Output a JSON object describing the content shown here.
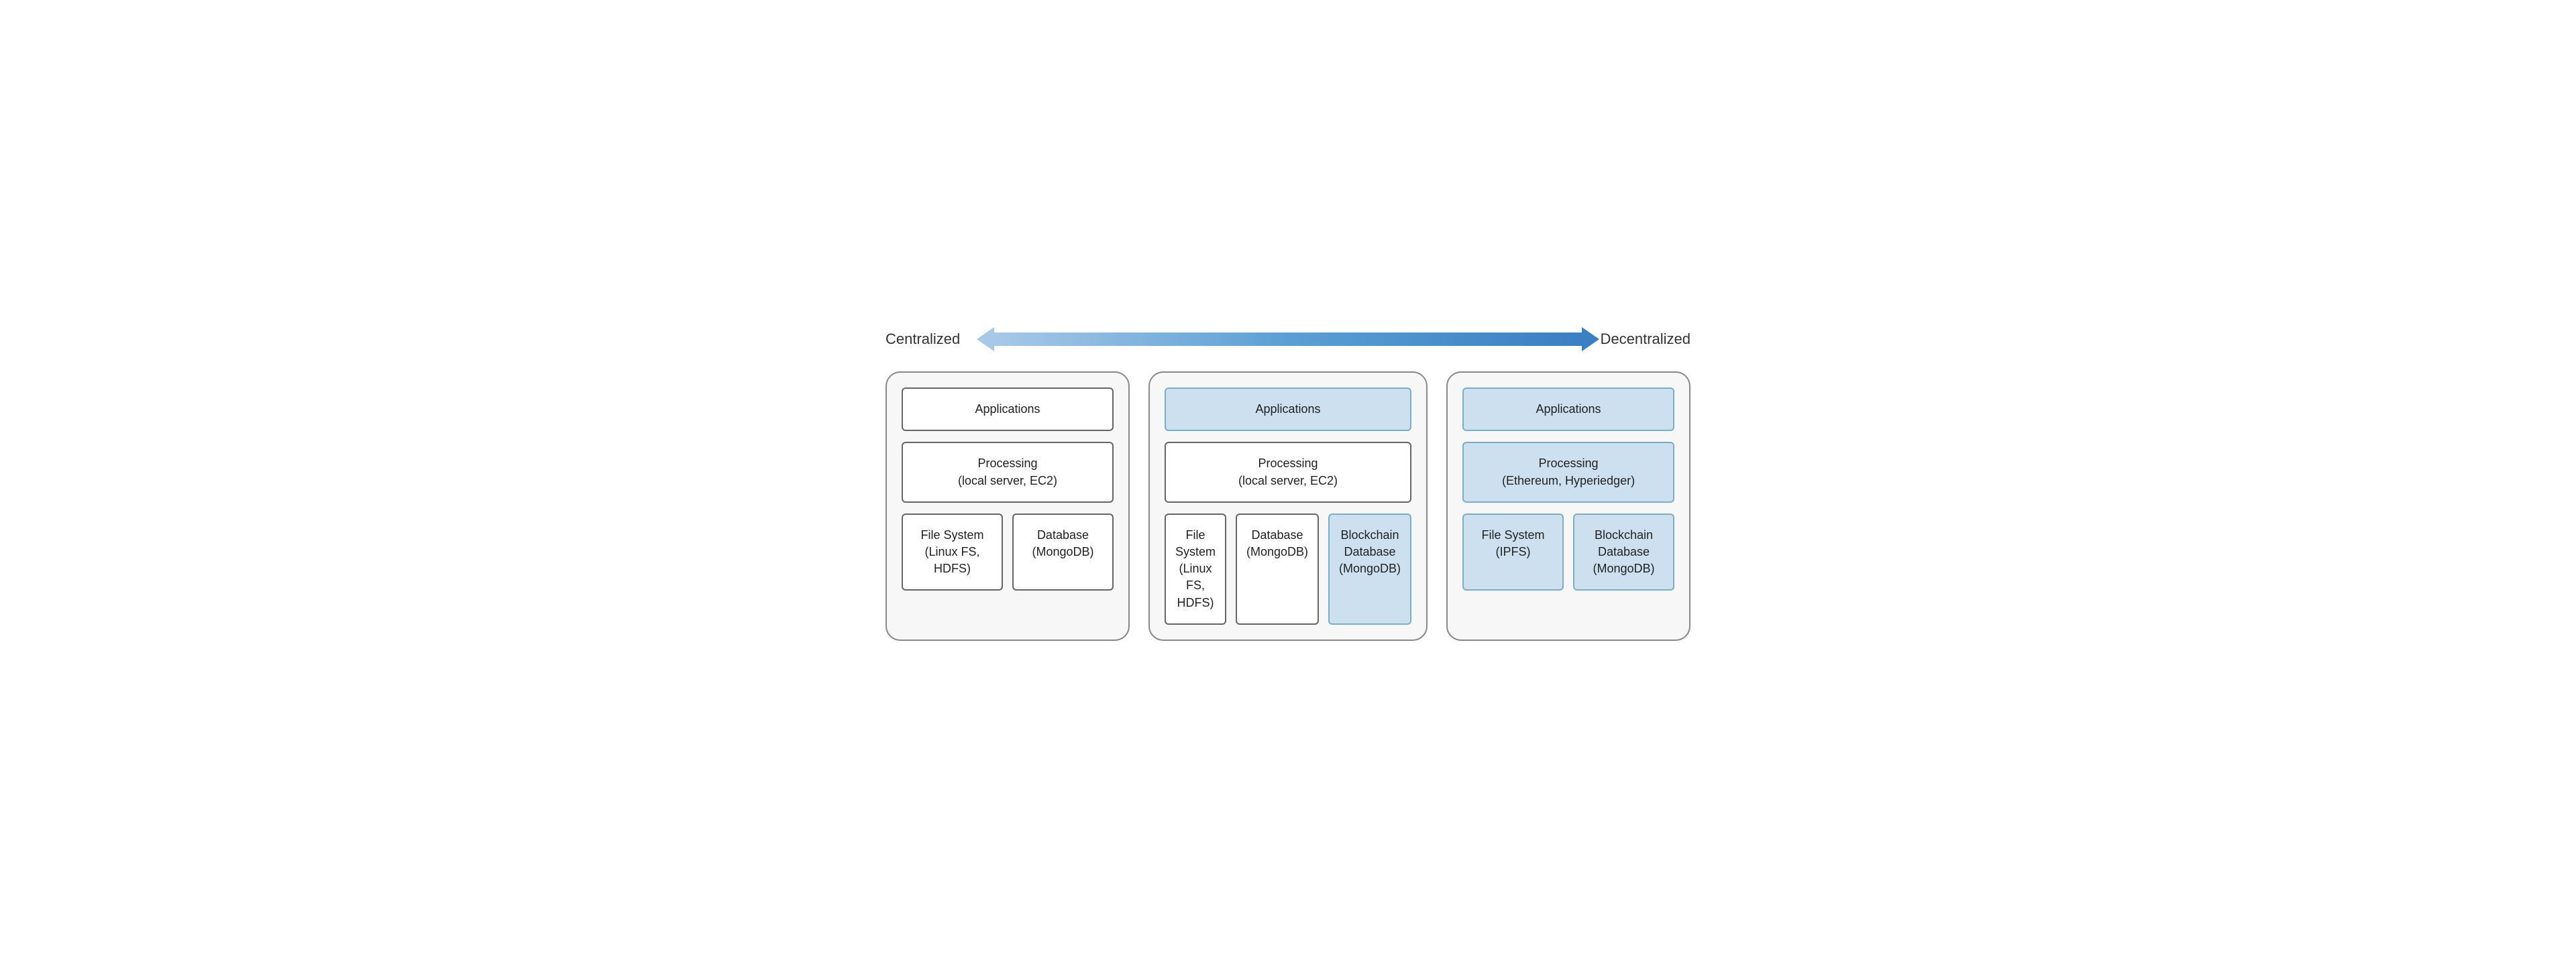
{
  "arrow": {
    "left_label": "Centralized",
    "right_label": "Decentralized"
  },
  "columns": [
    {
      "id": "col1",
      "applications": {
        "label": "Applications",
        "blue": false
      },
      "processing": {
        "label": "Processing\n(local server, EC2)",
        "blue": false
      },
      "storage_row": [
        {
          "label": "File System\n(Linux FS,\nHDFS)",
          "blue": false
        },
        {
          "label": "Database\n(MongoDB)",
          "blue": false
        }
      ]
    },
    {
      "id": "col2",
      "applications": {
        "label": "Applications",
        "blue": true
      },
      "processing": {
        "label": "Processing\n(local server, EC2)",
        "blue": false
      },
      "storage_row": [
        {
          "label": "File System\n(Linux FS,\nHDFS)",
          "blue": false
        },
        {
          "label": "Database\n(MongoDB)",
          "blue": false
        },
        {
          "label": "Blockchain\nDatabase\n(MongoDB)",
          "blue": true
        }
      ]
    },
    {
      "id": "col3",
      "applications": {
        "label": "Applications",
        "blue": true
      },
      "processing": {
        "label": "Processing\n(Ethereum, Hyperiedger)",
        "blue": true
      },
      "storage_row": [
        {
          "label": "File System\n(IPFS)",
          "blue": true
        },
        {
          "label": "Blockchain\nDatabase\n(MongoDB)",
          "blue": true
        }
      ]
    }
  ]
}
